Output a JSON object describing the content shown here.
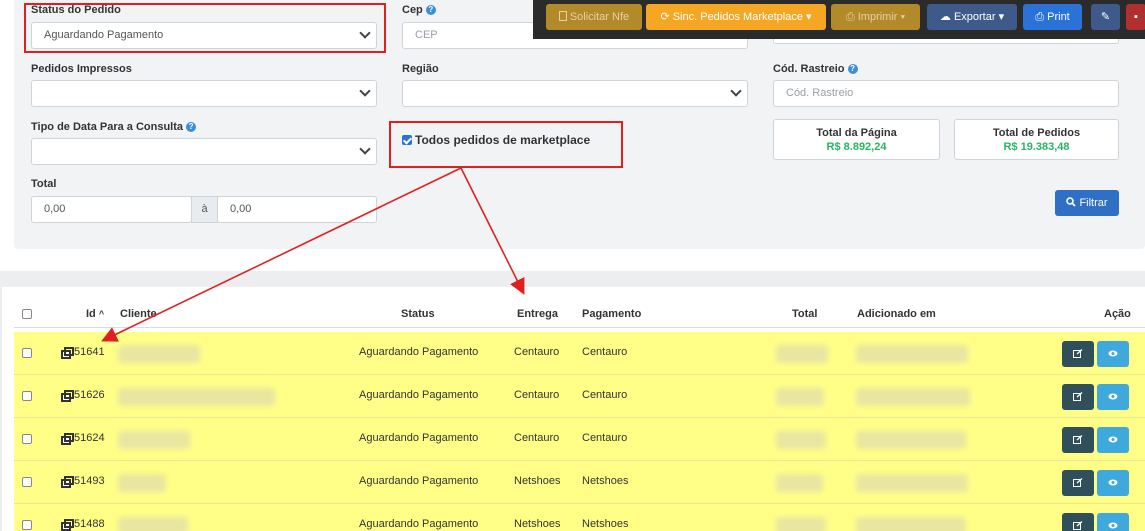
{
  "filters": {
    "status_label": "Status do Pedido",
    "status_value": "Aguardando Pagamento",
    "cep_label": "Cep",
    "cep_placeholder": "CEP",
    "impressos_label": "Pedidos Impressos",
    "regiao_label": "Região",
    "rastreio_label": "Cód. Rastreio",
    "rastreio_placeholder": "Cód. Rastreio",
    "tipo_data_label": "Tipo de Data Para a Consulta",
    "marketplace_label": "Todos pedidos de marketplace",
    "total_label": "Total",
    "total_from": "0,00",
    "total_sep": "à",
    "total_to": "0,00",
    "filtrar_button": "Filtrar"
  },
  "totals": {
    "page_title": "Total da Página",
    "page_value": "R$ 8.892,24",
    "orders_title": "Total de Pedidos",
    "orders_value": "R$ 19.383,48"
  },
  "toolbar": {
    "nfe": "Solicitar Nfe",
    "sync": "Sinc. Pedidos Marketplace",
    "imprimir": "Imprimir",
    "exportar": "Exportar",
    "print": "Print"
  },
  "table": {
    "headers": {
      "id": "Id",
      "cliente": "Cliente",
      "status": "Status",
      "entrega": "Entrega",
      "pagamento": "Pagamento",
      "total": "Total",
      "adicionado": "Adicionado em",
      "acao": "Ação"
    },
    "rows": [
      {
        "id": "51641",
        "status": "Aguardando Pagamento",
        "entrega": "Centauro",
        "pagamento": "Centauro"
      },
      {
        "id": "51626",
        "status": "Aguardando Pagamento",
        "entrega": "Centauro",
        "pagamento": "Centauro"
      },
      {
        "id": "51624",
        "status": "Aguardando Pagamento",
        "entrega": "Centauro",
        "pagamento": "Centauro"
      },
      {
        "id": "51493",
        "status": "Aguardando Pagamento",
        "entrega": "Netshoes",
        "pagamento": "Netshoes"
      },
      {
        "id": "51488",
        "status": "Aguardando Pagamento",
        "entrega": "Netshoes",
        "pagamento": "Netshoes"
      }
    ]
  },
  "colors": {
    "row_highlight": "#ffff88",
    "annotation": "#e02020",
    "total_green": "#28b463",
    "sync_orange": "#f5a623",
    "print_blue": "#2a72d8"
  }
}
